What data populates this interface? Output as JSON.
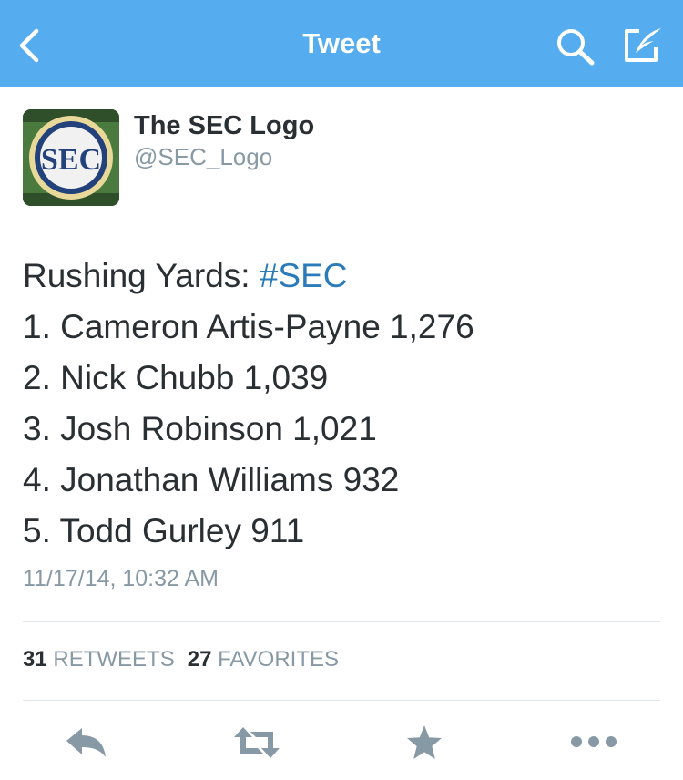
{
  "navbar": {
    "title": "Tweet",
    "back_icon": "chevron-left-icon",
    "search_icon": "search-icon",
    "compose_icon": "compose-icon",
    "background_color": "#55acee"
  },
  "tweet": {
    "author": {
      "name": "The SEC Logo",
      "handle": "@SEC_Logo",
      "avatar_text": "SEC"
    },
    "text_prefix": "Rushing Yards: ",
    "hashtag": "#SEC",
    "lines": [
      "1. Cameron Artis-Payne 1,276",
      "2. Nick Chubb 1,039",
      "3. Josh Robinson 1,021",
      "4. Jonathan Williams 932",
      "5. Todd Gurley 911"
    ],
    "timestamp": "11/17/14, 10:32 AM",
    "retweets": {
      "count": "31",
      "label": "RETWEETS"
    },
    "favorites": {
      "count": "27",
      "label": "FAVORITES"
    }
  },
  "actions": [
    {
      "name": "reply",
      "icon": "reply-icon"
    },
    {
      "name": "retweet",
      "icon": "retweet-icon"
    },
    {
      "name": "favorite",
      "icon": "star-icon"
    },
    {
      "name": "more",
      "icon": "more-icon"
    }
  ],
  "colors": {
    "hashtag": "#2b7bb9",
    "secondary_text": "#8899a6",
    "action_icon": "#8899a6"
  }
}
